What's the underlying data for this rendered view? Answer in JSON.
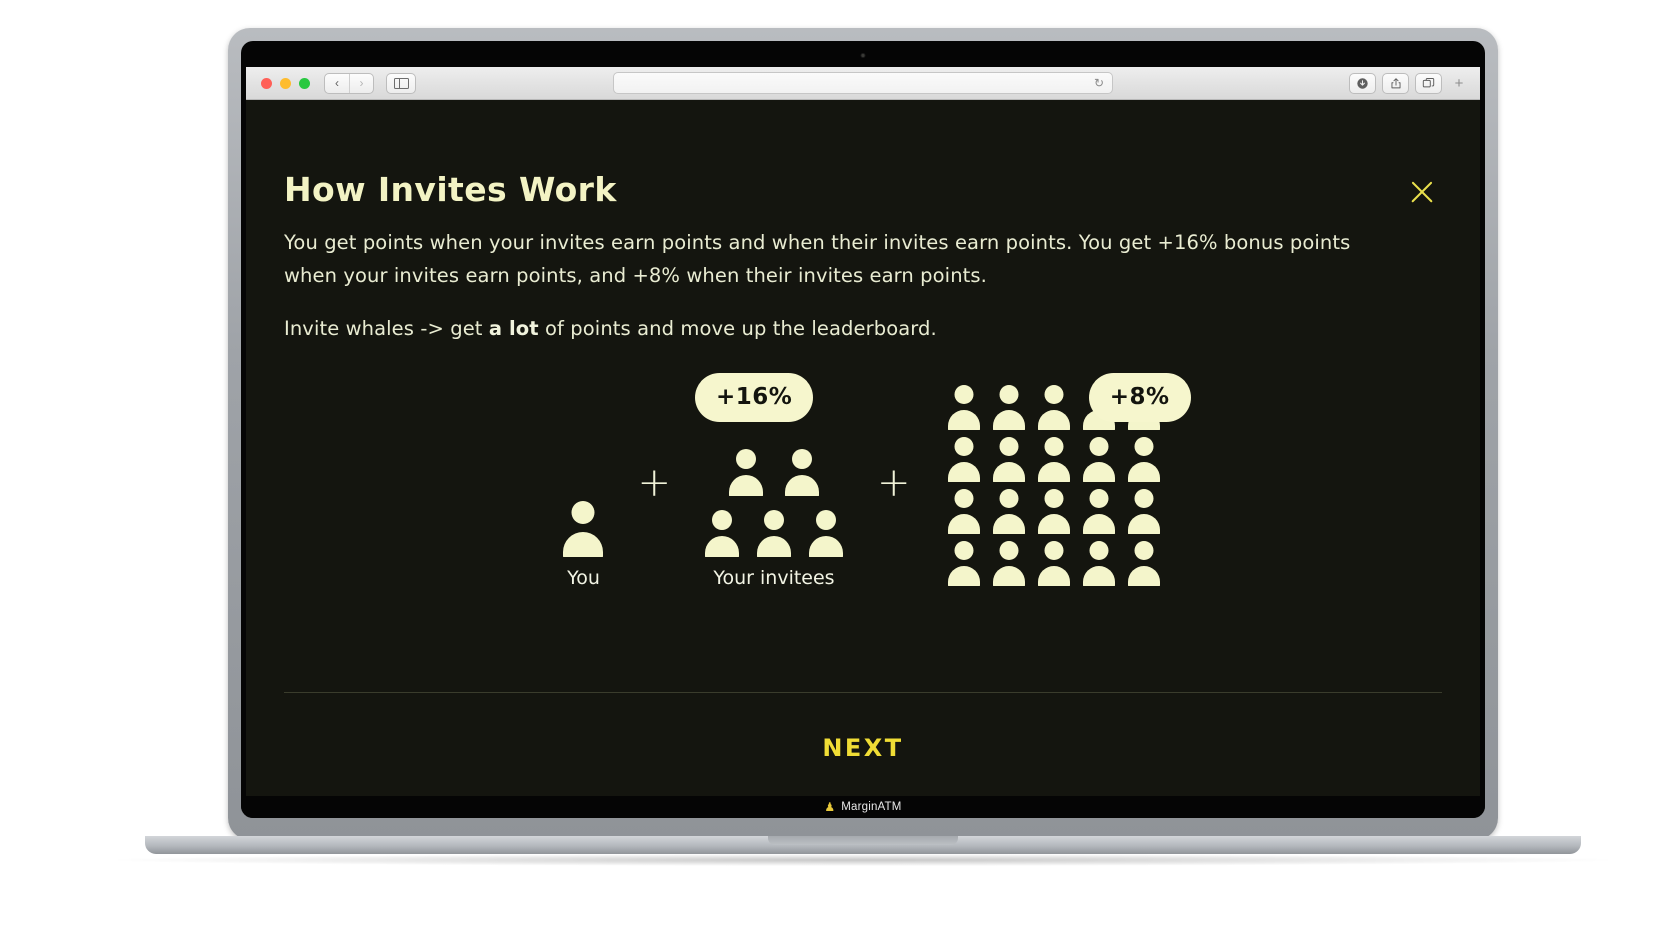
{
  "browser": {
    "traffic_lights": [
      "close",
      "minimize",
      "maximize"
    ],
    "back_label": "‹",
    "forward_label": "›",
    "sidebar_icon": "sidebar-icon",
    "url_value": "",
    "url_placeholder": "",
    "reload_label": "↻",
    "tools": [
      {
        "name": "downloads-icon",
        "glyph": "⬇"
      },
      {
        "name": "share-icon",
        "glyph": "↑"
      },
      {
        "name": "tab-overview-icon",
        "glyph": "⧉"
      }
    ],
    "new_tab_label": "+"
  },
  "modal": {
    "title": "How Invites Work",
    "close_label": "✕",
    "paragraph_1": "You get points when your invites earn points and when their invites earn points. You get +16% bonus points when your invites earn points, and +8% when their invites earn points.",
    "paragraph_2_before": "Invite whales -> get ",
    "paragraph_2_strong": "a lot",
    "paragraph_2_after": " of points and move up the leaderboard.",
    "next_label": "NEXT"
  },
  "diagram": {
    "you": {
      "label": "You",
      "count": 1
    },
    "plus_1": "+",
    "invitees": {
      "label": "Your invitees",
      "badge": "+16%",
      "row_top_count": 2,
      "row_bottom_count": 3,
      "count": 5
    },
    "plus_2": "+",
    "second_degree": {
      "label": "",
      "badge": "+8%",
      "columns": 5,
      "rows": 4,
      "count": 20
    }
  },
  "device": {
    "brand_logo": "♟",
    "brand_name": "MarginATM"
  },
  "colors": {
    "page_background": "#14150f",
    "cream": "#f4f5cb",
    "title": "#f3f3c4",
    "body_text": "#e9ecd2",
    "accent_yellow": "#f0dd35",
    "close_yellow": "#e9e04c",
    "badge_background": "#f6f6cd",
    "badge_text": "#13140e",
    "divider": "#3a3c2c"
  }
}
